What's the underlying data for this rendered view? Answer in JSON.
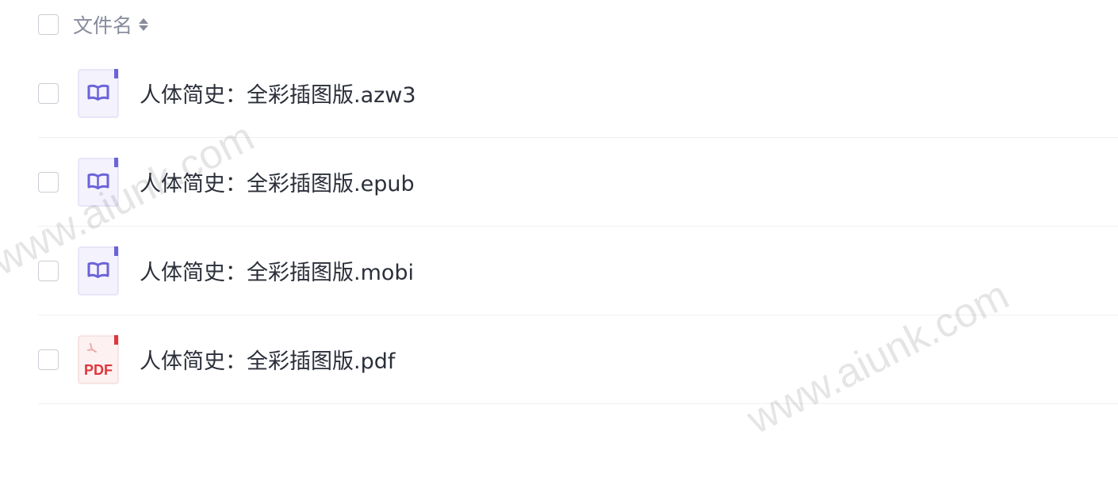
{
  "header": {
    "column_label": "文件名",
    "sort_icon": "sort-caret-icon"
  },
  "files": [
    {
      "name": "人体简史：全彩插图版.azw3",
      "icon": "ebook-icon",
      "icon_color": "#6b63d9"
    },
    {
      "name": "人体简史：全彩插图版.epub",
      "icon": "ebook-icon",
      "icon_color": "#6b63d9"
    },
    {
      "name": "人体简史：全彩插图版.mobi",
      "icon": "ebook-icon",
      "icon_color": "#6b63d9"
    },
    {
      "name": "人体简史：全彩插图版.pdf",
      "icon": "pdf-icon",
      "icon_color": "#e0363b",
      "icon_label": "PDF"
    }
  ],
  "watermarks": [
    "www.aiunk.com",
    "www.aiunk.com"
  ],
  "colors": {
    "ebook_accent": "#6b63d9",
    "pdf_accent": "#e0363b",
    "divider": "#eef0f3"
  }
}
